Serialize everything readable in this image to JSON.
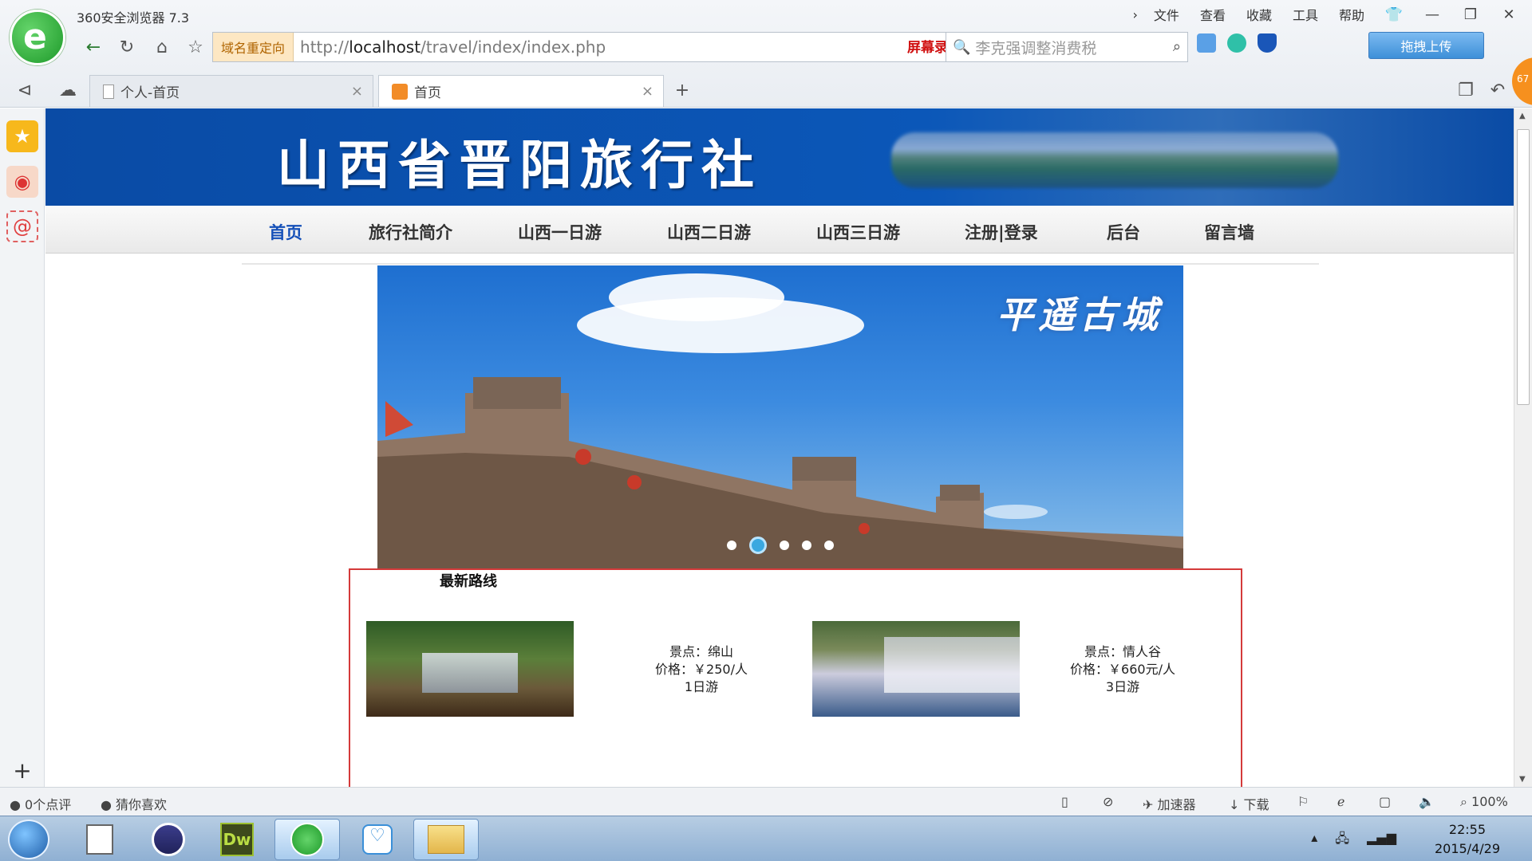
{
  "browser": {
    "app_title": "360安全浏览器 7.3",
    "menu": [
      "文件",
      "查看",
      "收藏",
      "工具",
      "帮助"
    ],
    "address": {
      "badge": "域名重定向",
      "url_prefix": "http://",
      "url_host": "localhost",
      "url_path": "/travel/index/index.php"
    },
    "recorder_banner": "屏幕录像专家  未注册",
    "search_placeholder": "李克强调整消费税",
    "upload_button": "拖拽上传",
    "tabs": [
      {
        "label": "个人-首页",
        "active": false
      },
      {
        "label": "首页",
        "active": true
      }
    ],
    "corner_badge": "67"
  },
  "page": {
    "banner_title": "山西省晋阳旅行社",
    "nav": [
      {
        "label": "首页",
        "active": true
      },
      {
        "label": "旅行社简介",
        "active": false
      },
      {
        "label": "山西一日游",
        "active": false
      },
      {
        "label": "山西二日游",
        "active": false
      },
      {
        "label": "山西三日游",
        "active": false
      },
      {
        "label": "注册|登录",
        "active": false
      },
      {
        "label": "后台",
        "active": false
      },
      {
        "label": "留言墙",
        "active": false
      }
    ],
    "slider": {
      "caption": "平遥古城",
      "dot_count": 5,
      "active_dot": 1
    },
    "routes": {
      "title": "最新路线",
      "items": [
        {
          "spot": "景点：绵山",
          "price": "价格：￥250/人",
          "duration": "1日游"
        },
        {
          "spot": "景点：情人谷",
          "price": "价格：￥660元/人",
          "duration": "3日游"
        }
      ]
    }
  },
  "status_bar": {
    "comments": "0个点评",
    "guess": "猜你喜欢",
    "accelerator": "加速器",
    "download": "下载",
    "zoom": "100%"
  },
  "taskbar": {
    "time": "22:55",
    "date": "2015/4/29",
    "dw_label": "Dw"
  }
}
